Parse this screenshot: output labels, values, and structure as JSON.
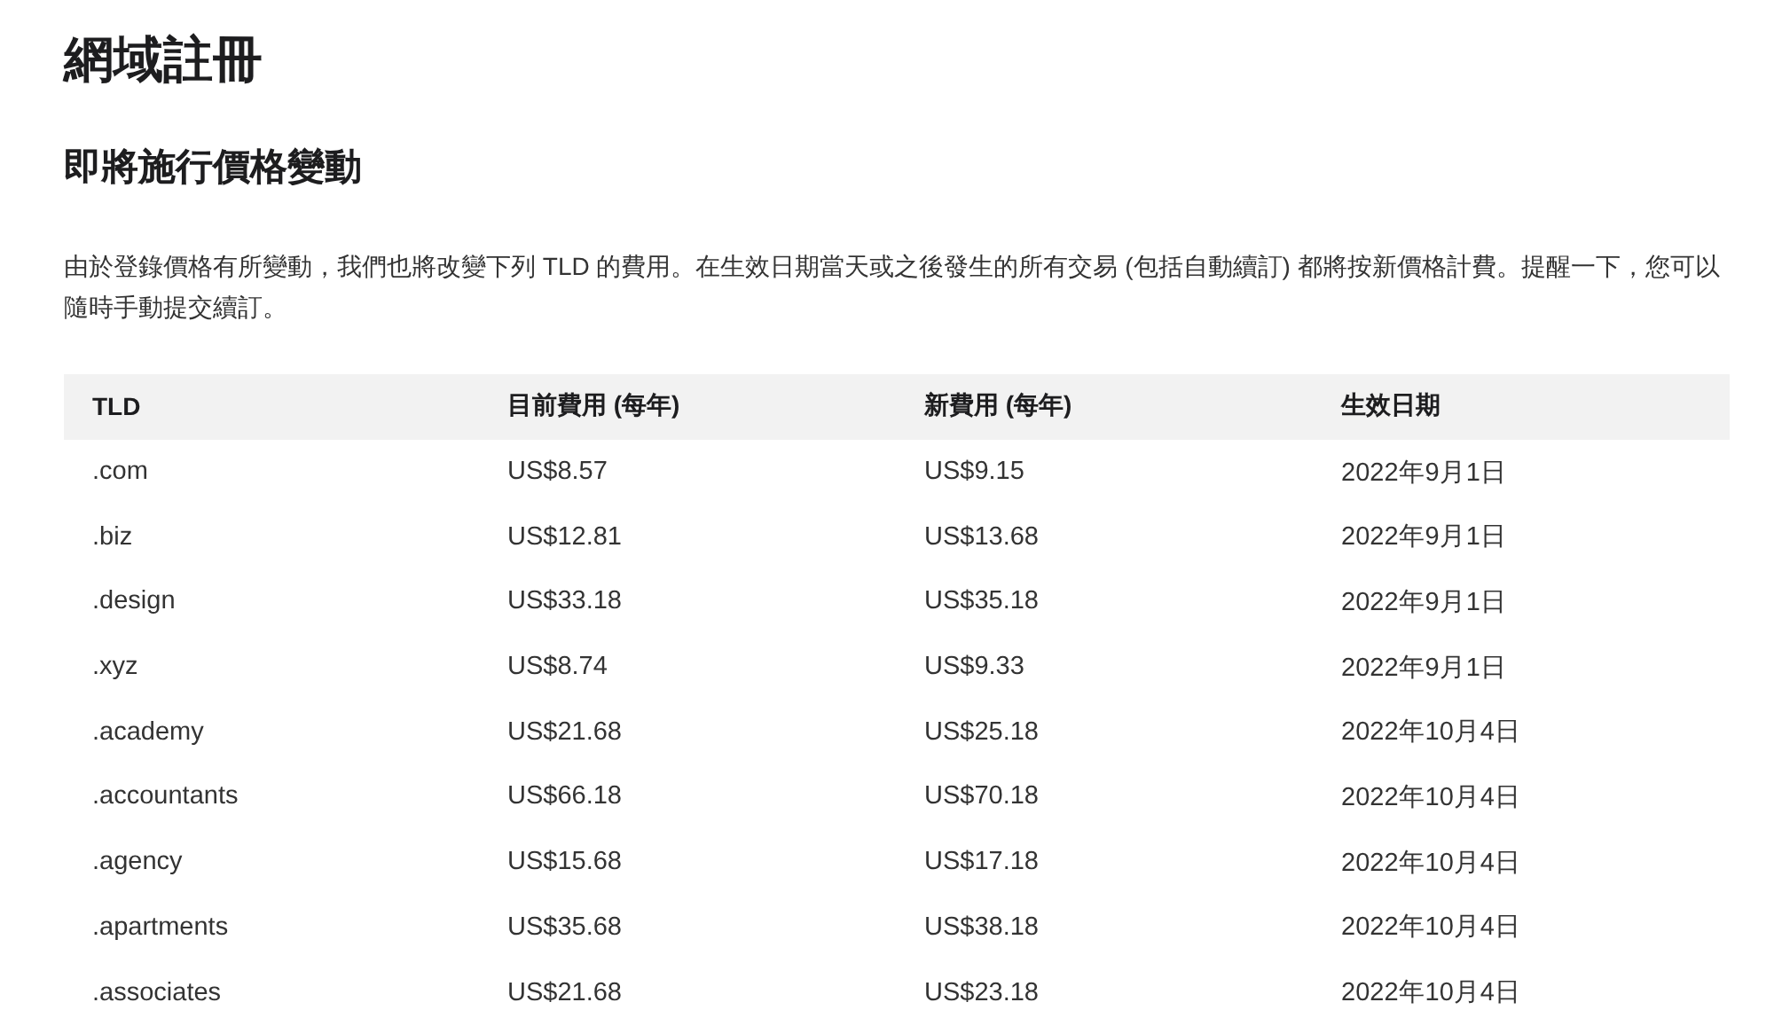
{
  "title": "網域註冊",
  "section": {
    "heading": "即將施行價格變動",
    "description": "由於登錄價格有所變動，我們也將改變下列 TLD 的費用。在生效日期當天或之後發生的所有交易 (包括自動續訂) 都將按新價格計費。提醒一下，您可以隨時手動提交續訂。"
  },
  "table": {
    "columns": [
      "TLD",
      "目前費用 (每年)",
      "新費用 (每年)",
      "生效日期"
    ],
    "rows": [
      [
        ".com",
        "US$8.57",
        "US$9.15",
        "2022年9月1日"
      ],
      [
        ".biz",
        "US$12.81",
        "US$13.68",
        "2022年9月1日"
      ],
      [
        ".design",
        "US$33.18",
        "US$35.18",
        "2022年9月1日"
      ],
      [
        ".xyz",
        "US$8.74",
        "US$9.33",
        "2022年9月1日"
      ],
      [
        ".academy",
        "US$21.68",
        "US$25.18",
        "2022年10月4日"
      ],
      [
        ".accountants",
        "US$66.18",
        "US$70.18",
        "2022年10月4日"
      ],
      [
        ".agency",
        "US$15.68",
        "US$17.18",
        "2022年10月4日"
      ],
      [
        ".apartments",
        "US$35.68",
        "US$38.18",
        "2022年10月4日"
      ],
      [
        ".associates",
        "US$21.68",
        "US$23.18",
        "2022年10月4日"
      ]
    ]
  }
}
